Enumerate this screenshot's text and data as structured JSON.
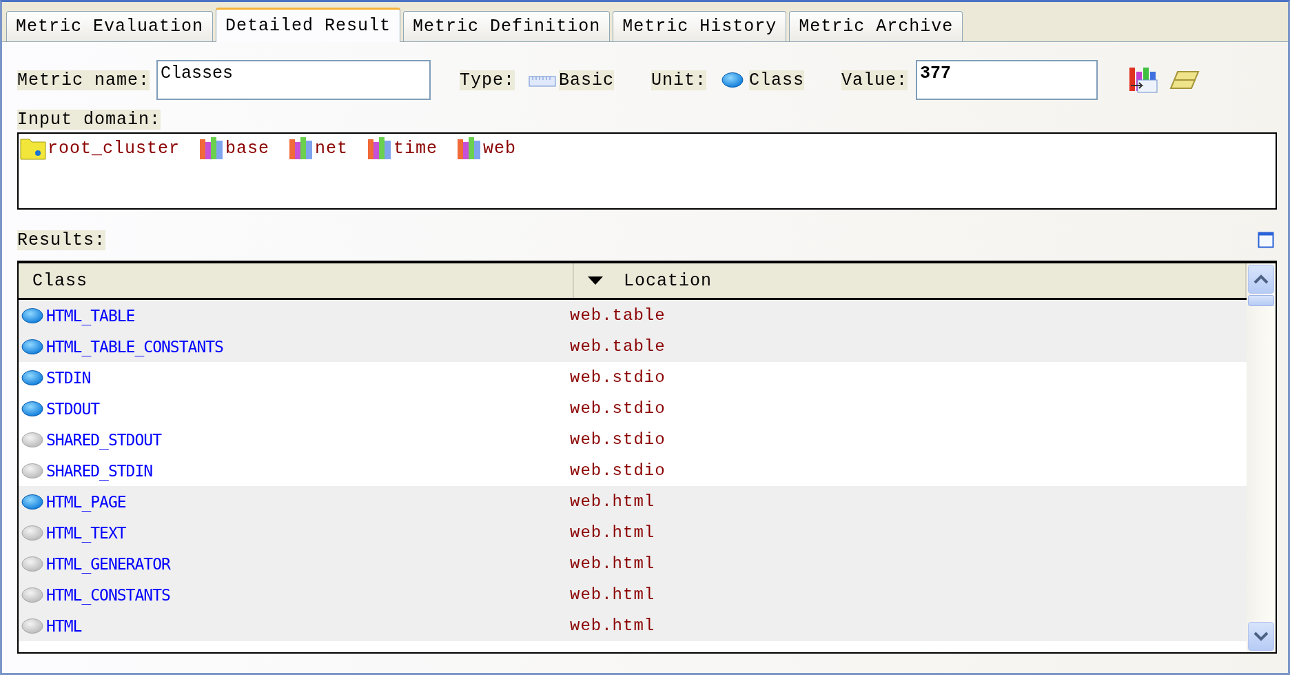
{
  "tabs": [
    {
      "label": "Metric Evaluation",
      "selected": false
    },
    {
      "label": "Detailed Result",
      "selected": true
    },
    {
      "label": "Metric Definition",
      "selected": false
    },
    {
      "label": "Metric History",
      "selected": false
    },
    {
      "label": "Metric Archive",
      "selected": false
    }
  ],
  "metric_name": {
    "label": "Metric name:",
    "value": "Classes"
  },
  "type": {
    "label": "Type:",
    "value": "Basic"
  },
  "unit": {
    "label": "Unit:",
    "value": "Class"
  },
  "value": {
    "label": "Value:",
    "value": "377"
  },
  "input_domain": {
    "label": "Input domain:",
    "items": [
      {
        "kind": "cluster",
        "label": "root_cluster"
      },
      {
        "kind": "library",
        "label": "base"
      },
      {
        "kind": "library",
        "label": "net"
      },
      {
        "kind": "library",
        "label": "time"
      },
      {
        "kind": "library",
        "label": "web"
      }
    ]
  },
  "results": {
    "label": "Results:",
    "columns": [
      "Class",
      "Location"
    ],
    "rows": [
      {
        "class": "HTML_TABLE",
        "location": "web.table",
        "active": true,
        "shaded": true
      },
      {
        "class": "HTML_TABLE_CONSTANTS",
        "location": "web.table",
        "active": true,
        "shaded": true
      },
      {
        "class": "STDIN",
        "location": "web.stdio",
        "active": true,
        "shaded": false
      },
      {
        "class": "STDOUT",
        "location": "web.stdio",
        "active": true,
        "shaded": false
      },
      {
        "class": "SHARED_STDOUT",
        "location": "web.stdio",
        "active": false,
        "shaded": false
      },
      {
        "class": "SHARED_STDIN",
        "location": "web.stdio",
        "active": false,
        "shaded": false
      },
      {
        "class": "HTML_PAGE",
        "location": "web.html",
        "active": true,
        "shaded": true
      },
      {
        "class": "HTML_TEXT",
        "location": "web.html",
        "active": false,
        "shaded": true
      },
      {
        "class": "HTML_GENERATOR",
        "location": "web.html",
        "active": false,
        "shaded": true
      },
      {
        "class": "HTML_CONSTANTS",
        "location": "web.html",
        "active": false,
        "shaded": true
      },
      {
        "class": "HTML",
        "location": "web.html",
        "active": false,
        "shaded": true
      }
    ]
  }
}
